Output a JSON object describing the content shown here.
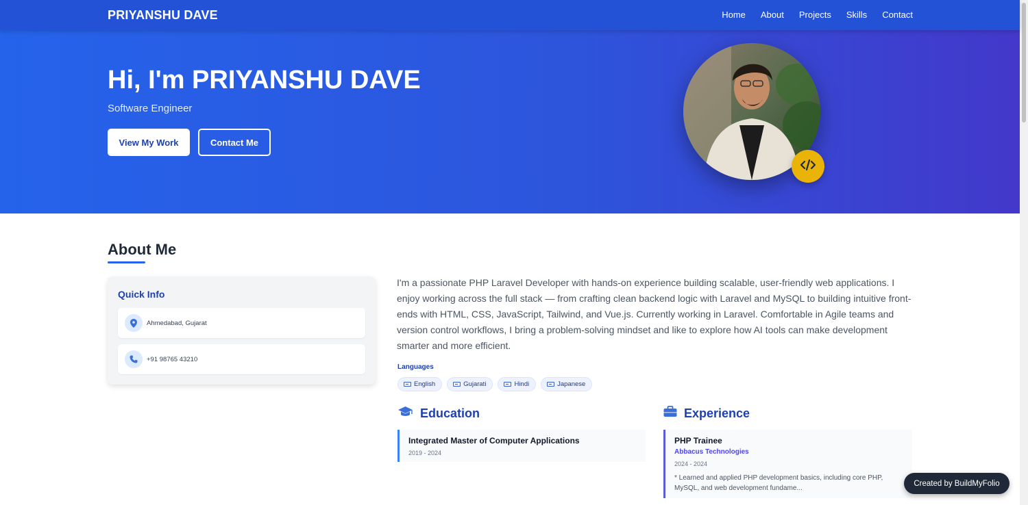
{
  "header": {
    "brand": "PRIYANSHU DAVE",
    "nav": [
      "Home",
      "About",
      "Projects",
      "Skills",
      "Contact"
    ]
  },
  "hero": {
    "heading": "Hi, I'm PRIYANSHU DAVE",
    "subtitle": "Software Engineer",
    "primary_button": "View My Work",
    "secondary_button": "Contact Me",
    "badge_icon": "code-icon"
  },
  "about": {
    "title": "About Me",
    "quick_info": {
      "title": "Quick Info",
      "location": "Ahmedabad, Gujarat",
      "phone": "+91 98765 43210"
    },
    "bio": "I'm a passionate PHP Laravel Developer with hands-on experience building scalable, user-friendly web applications. I enjoy working across the full stack — from crafting clean backend logic with Laravel and MySQL to building intuitive front-ends with HTML, CSS, JavaScript, Tailwind, and Vue.js. Currently working in Laravel. Comfortable in Agile teams and version control workflows, I bring a problem-solving mindset and like to explore how AI tools can make development smarter and more efficient.",
    "languages_label": "Languages",
    "languages": [
      "English",
      "Gujarati",
      "Hindi",
      "Japanese"
    ]
  },
  "education": {
    "title": "Education",
    "items": [
      {
        "degree": "Integrated Master of Computer Applications",
        "years": "2019 - 2024"
      }
    ]
  },
  "experience": {
    "title": "Experience",
    "items": [
      {
        "role": "PHP Trainee",
        "company": "Abbacus Technologies",
        "years": "2024 - 2024",
        "description": "* Learned and applied PHP development basics, including core PHP, MySQL, and web development fundame..."
      }
    ]
  },
  "credit": "Created by BuildMyFolio",
  "colors": {
    "nav_bg": "#2452d6",
    "accent": "#2563eb",
    "badge": "#eab308",
    "heading_blue": "#1e40af"
  }
}
